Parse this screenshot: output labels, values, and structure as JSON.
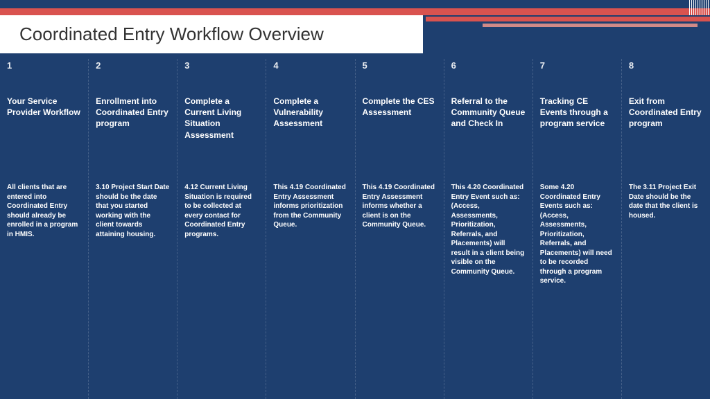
{
  "title": "Coordinated Entry Workflow Overview",
  "steps": [
    {
      "num": "1",
      "title": "Your Service Provider Workflow",
      "body": "All clients that are entered into Coordinated Entry should already be enrolled in a program in HMIS."
    },
    {
      "num": "2",
      "title": "Enrollment into Coordinated Entry program",
      "body": "3.10 Project Start Date should be the date that you started working with the client towards attaining housing."
    },
    {
      "num": "3",
      "title": "Complete a Current Living Situation Assessment",
      "body": "4.12 Current Living Situation is required to be collected at every contact for Coordinated Entry programs."
    },
    {
      "num": "4",
      "title": "Complete a Vulnerability Assessment",
      "body": "This 4.19 Coordinated Entry Assessment informs prioritization from the Community Queue."
    },
    {
      "num": "5",
      "title": "Complete the CES Assessment",
      "body": "This 4.19 Coordinated Entry Assessment informs whether a client is on the Community Queue."
    },
    {
      "num": "6",
      "title": "Referral to the Community Queue and Check In",
      "body": "This 4.20 Coordinated Entry Event such as: (Access, Assessments, Prioritization, Referrals, and Placements) will result in a client being visible on the Community Queue."
    },
    {
      "num": "7",
      "title": "Tracking CE Events through a program service",
      "body": "Some 4.20 Coordinated Entry Events such as: (Access, Assessments, Prioritization, Referrals, and Placements) will need to be recorded through a program service."
    },
    {
      "num": "8",
      "title": "Exit from Coordinated Entry program",
      "body": "The 3.11 Project Exit Date should be the date that the client is housed."
    }
  ]
}
